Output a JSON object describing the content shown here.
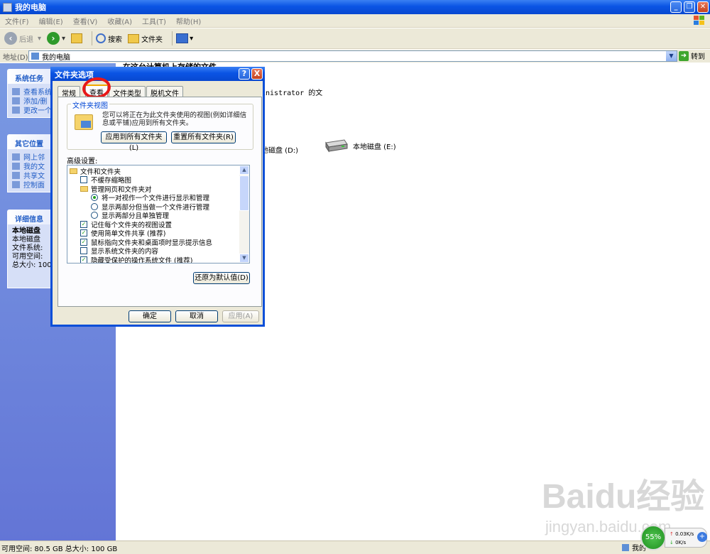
{
  "window": {
    "title": "我的电脑"
  },
  "menu": [
    "文件(F)",
    "编辑(E)",
    "查看(V)",
    "收藏(A)",
    "工具(T)",
    "帮助(H)"
  ],
  "toolbar": {
    "back": "后退",
    "search": "搜索",
    "folders": "文件夹"
  },
  "address": {
    "label": "地址(D)",
    "value": "我的电脑",
    "go": "转到"
  },
  "sidebar": {
    "system_tasks": {
      "title": "系统任务",
      "items": [
        "查看系统",
        "添加/删",
        "更改一个"
      ]
    },
    "other_places": {
      "title": "其它位置",
      "items": [
        "网上邻",
        "我的文",
        "共享文",
        "控制面"
      ]
    },
    "details": {
      "title": "详细信息",
      "name": "本地磁盘",
      "lines": [
        "本地磁盘",
        "文件系统:",
        "可用空间:",
        "总大小: 100"
      ]
    }
  },
  "main": {
    "header": "在这台计算机上存储的文件",
    "admin_text": "inistrator 的文",
    "drive_d": "地磁盘 (D:)",
    "drive_e": "本地磁盘 (E:)"
  },
  "dialog": {
    "title": "文件夹选项",
    "help": "?",
    "close": "X",
    "tabs": [
      "常规",
      "查看",
      "文件类型",
      "脱机文件"
    ],
    "folder_views": {
      "legend": "文件夹视图",
      "desc": "您可以将正在为此文件夹使用的视图(例如详细信息或平铺)应用到所有文件夹。",
      "apply_all": "应用到所有文件夹(L)",
      "reset_all": "重置所有文件夹(R)"
    },
    "advanced_label": "高级设置:",
    "tree": [
      {
        "type": "folder",
        "text": "文件和文件夹"
      },
      {
        "type": "check",
        "checked": false,
        "text": "不缓存缩略图"
      },
      {
        "type": "folder",
        "text": "管理网页和文件夹对"
      },
      {
        "type": "radio",
        "checked": true,
        "text": "将一对视作一个文件进行显示和管理"
      },
      {
        "type": "radio",
        "checked": false,
        "text": "显示两部分但当做一个文件进行管理"
      },
      {
        "type": "radio",
        "checked": false,
        "text": "显示两部分且单独管理"
      },
      {
        "type": "check",
        "checked": true,
        "text": "记住每个文件夹的视图设置"
      },
      {
        "type": "check",
        "checked": true,
        "text": "使用简单文件共享 (推荐)"
      },
      {
        "type": "check",
        "checked": true,
        "text": "鼠标指向文件夹和桌面项时显示提示信息"
      },
      {
        "type": "check",
        "checked": false,
        "text": "显示系统文件夹的内容"
      },
      {
        "type": "check",
        "checked": true,
        "text": "隐藏受保护的操作系统文件 (推荐)"
      }
    ],
    "restore_defaults": "还原为默认值(D)",
    "ok": "确定",
    "cancel": "取消",
    "apply": "应用(A)"
  },
  "status": {
    "left": "可用空间: 80.5 GB 总大小: 100 GB",
    "right": "我的"
  },
  "net": {
    "percent": "55%",
    "up": "0.03K/s",
    "down": "0K/s"
  },
  "watermark": {
    "logo": "Baidu经验",
    "url": "jingyan.baidu.com"
  }
}
